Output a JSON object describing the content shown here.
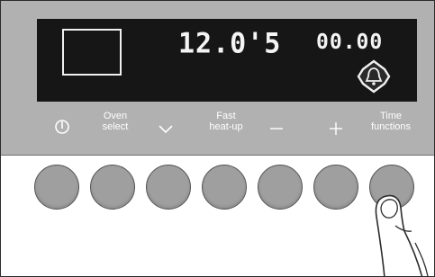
{
  "display": {
    "main_readout": "12.0'5",
    "timer_readout": "00.00",
    "bell_symbol": "bell-icon",
    "stop_symbol": "stop-box"
  },
  "controls": [
    {
      "key": "power",
      "label": "",
      "icon": "power-icon",
      "symbol": "⏻"
    },
    {
      "key": "oven_select",
      "label": "Oven\nselect",
      "icon": ""
    },
    {
      "key": "down",
      "label": "",
      "icon": "chevron-down-icon",
      "symbol": "⌄"
    },
    {
      "key": "fast_heat_up",
      "label": "Fast\nheat-up",
      "icon": ""
    },
    {
      "key": "minus",
      "label": "",
      "icon": "minus-icon",
      "symbol": "–"
    },
    {
      "key": "plus",
      "label": "",
      "icon": "plus-icon",
      "symbol": "+"
    },
    {
      "key": "time_functions",
      "label": "Time\nfunctions",
      "icon": ""
    }
  ],
  "colors": {
    "panel": "#b1b1b1",
    "display": "#161616",
    "button": "#9f9f9f",
    "text": "#ffffff"
  }
}
